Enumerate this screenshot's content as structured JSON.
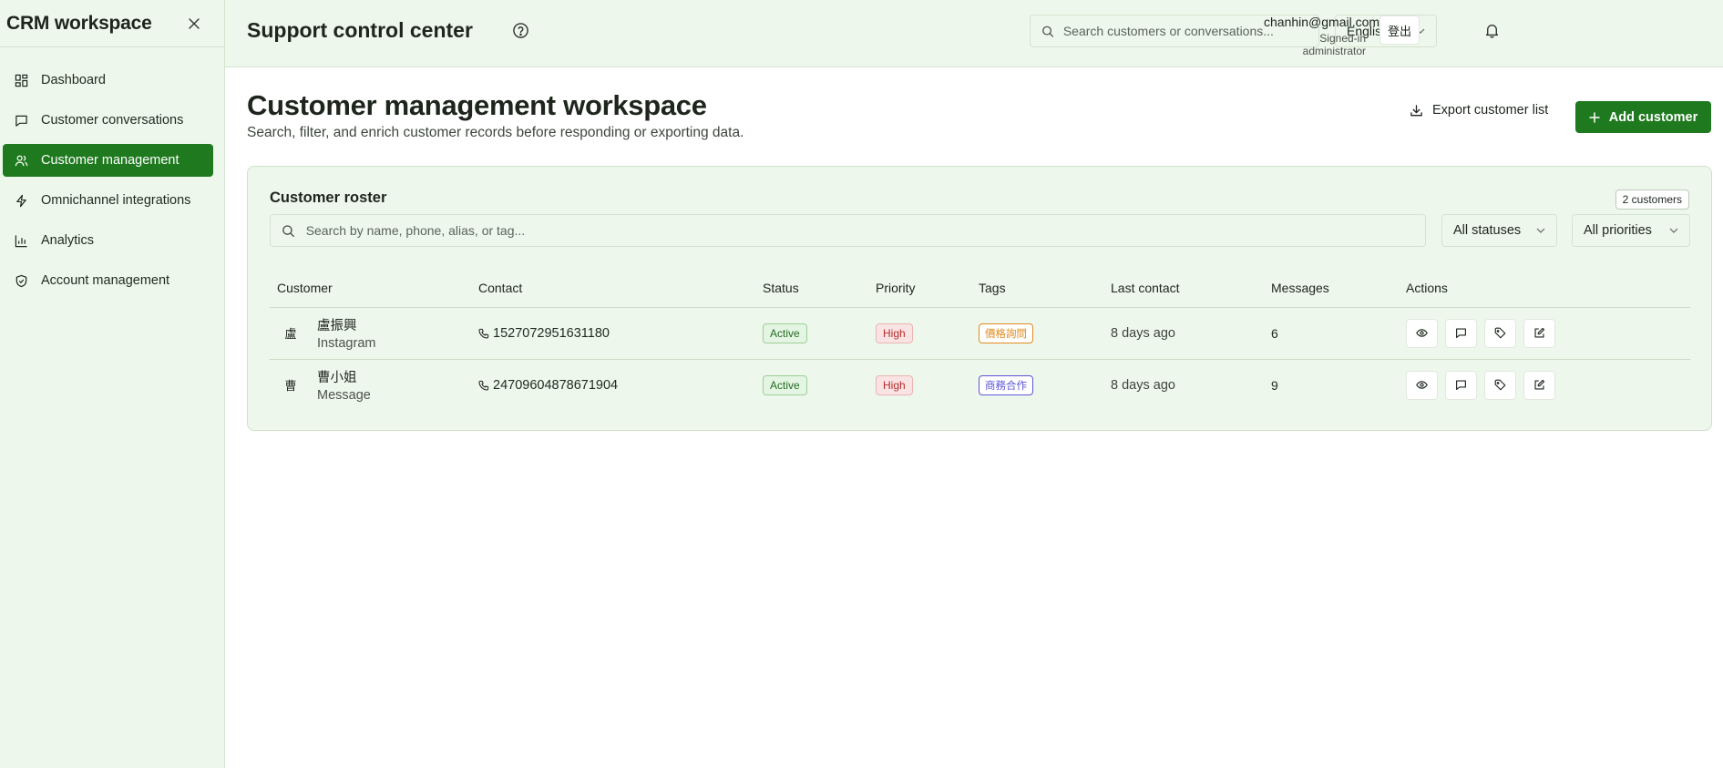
{
  "sidebar": {
    "brand": "CRM workspace",
    "items": [
      {
        "label": "Dashboard",
        "icon": "dashboard-icon"
      },
      {
        "label": "Customer conversations",
        "icon": "chat-icon"
      },
      {
        "label": "Customer management",
        "icon": "users-icon",
        "active": true
      },
      {
        "label": "Omnichannel integrations",
        "icon": "bolt-icon"
      },
      {
        "label": "Analytics",
        "icon": "bar-chart-icon"
      },
      {
        "label": "Account management",
        "icon": "shield-icon"
      }
    ]
  },
  "topbar": {
    "title": "Support control center",
    "search_placeholder": "Search customers or conversations...",
    "language": "English",
    "user_email": "chanhin@gmail.com",
    "user_role": "Signed-in administrator",
    "logout_label": "登出"
  },
  "main": {
    "title": "Customer management workspace",
    "subtitle": "Search, filter, and enrich customer records before responding or exporting data.",
    "export_label": "Export customer list",
    "add_label": "Add customer"
  },
  "roster": {
    "title": "Customer roster",
    "count": "2 customers",
    "search_placeholder": "Search by name, phone, alias, or tag...",
    "status_filter": "All statuses",
    "priority_filter": "All priorities",
    "columns": [
      "Customer",
      "Contact",
      "Status",
      "Priority",
      "Tags",
      "Last contact",
      "Messages",
      "Actions"
    ],
    "rows": [
      {
        "avatar": "盧",
        "name": "盧振興",
        "channel": "Instagram",
        "phone": "1527072951631180",
        "status": "Active",
        "priority": "High",
        "tag": "價格詢問",
        "tag_color": "#e08a1e",
        "last_contact": "8 days ago",
        "messages": "6"
      },
      {
        "avatar": "曹",
        "name": "曹小姐",
        "channel": "Message",
        "phone": "24709604878671904",
        "status": "Active",
        "priority": "High",
        "tag": "商務合作",
        "tag_color": "#5b55d6",
        "last_contact": "8 days ago",
        "messages": "9"
      }
    ]
  },
  "colors": {
    "accent": "#1f7a1f",
    "panel_bg": "#eef7ec"
  }
}
